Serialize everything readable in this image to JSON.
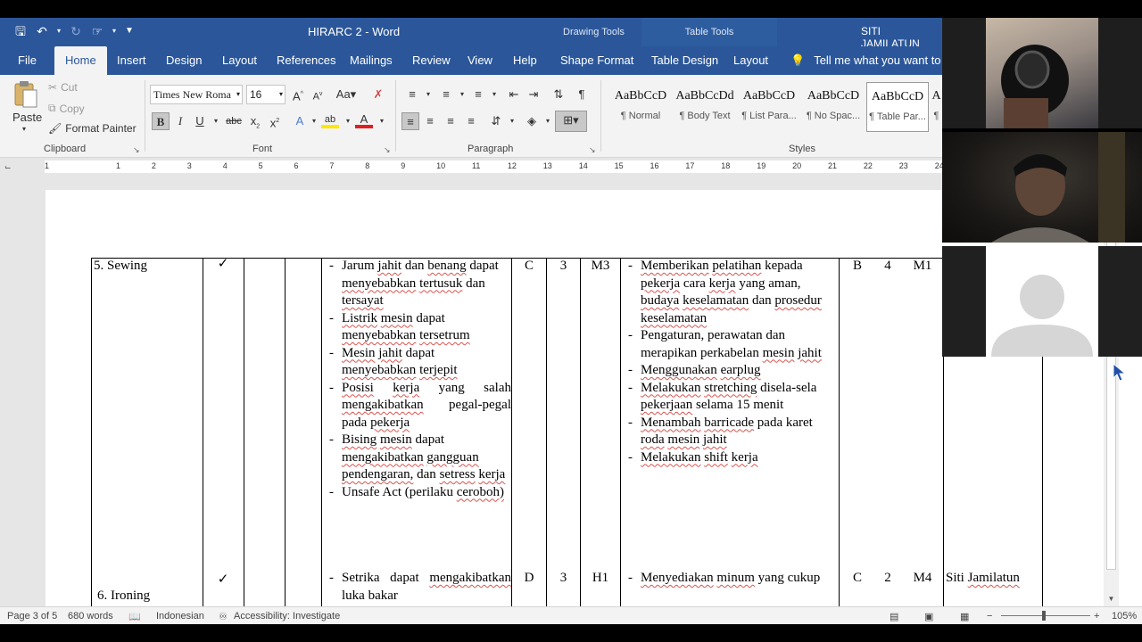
{
  "window": {
    "title": "HIRARC 2  -  Word",
    "user": "SITI JAMILATUN",
    "context_headers": [
      "Drawing Tools",
      "Table Tools"
    ]
  },
  "tabs": [
    "File",
    "Home",
    "Insert",
    "Design",
    "Layout",
    "References",
    "Mailings",
    "Review",
    "View",
    "Help",
    "Shape Format",
    "Table Design",
    "Layout"
  ],
  "active_tab": "Home",
  "tell_me": "Tell me what you want to d",
  "clipboard": {
    "paste": "Paste",
    "cut": "Cut",
    "copy": "Copy",
    "format_painter": "Format Painter",
    "label": "Clipboard"
  },
  "font": {
    "family": "Times New Roma",
    "size": "16",
    "label": "Font"
  },
  "paragraph": {
    "label": "Paragraph"
  },
  "styles": {
    "label": "Styles",
    "items": [
      {
        "sample": "AaBbCcD",
        "name": "¶ Normal"
      },
      {
        "sample": "AaBbCcDd",
        "name": "¶ Body Text"
      },
      {
        "sample": "AaBbCcD",
        "name": "¶ List Para..."
      },
      {
        "sample": "AaBbCcD",
        "name": "¶ No Spac..."
      },
      {
        "sample": "AaBbCcD",
        "name": "¶ Table Par..."
      },
      {
        "sample": "A",
        "name": "¶"
      }
    ]
  },
  "ruler": {
    "numbers": [
      "1",
      "1",
      "2",
      "3",
      "4",
      "5",
      "6",
      "7",
      "8",
      "9",
      "10",
      "11",
      "12",
      "13",
      "14",
      "15",
      "16",
      "17",
      "18",
      "19",
      "20",
      "21",
      "22",
      "23",
      "24"
    ]
  },
  "document": {
    "rows": [
      {
        "activity": "5.  Sewing",
        "check": "✓",
        "hazards": [
          "Jarum jahit dan benang dapat menyebabkan tertusuk dan tersayat",
          "Listrik mesin dapat menyebabkan tersetrum",
          "Mesin jahit dapat menyebabkan terjepit",
          "Posisi kerja yang salah mengakibatkan pegal-pegal pada pekerja",
          "Bising mesin dapat mengakibatkan gangguan pendengaran, dan setress kerja",
          "Unsafe Act (perilaku ceroboh)"
        ],
        "likelihood": "C",
        "severity": "3",
        "risk": "M3",
        "controls": [
          "Memberikan pelatihan kepada pekerja cara kerja yang aman, budaya keselamatan dan prosedur keselamatan",
          "Pengaturan, perawatan dan merapikan perkabelan mesin jahit",
          "Menggunakan earplug",
          "Melakukan stretching disela-sela pekerjaan selama 15 menit",
          "Menambah barricade pada karet roda mesin jahit",
          "Melakukan shift kerja"
        ],
        "likelihood2": "B",
        "severity2": "4",
        "risk2": "M1",
        "pic": ""
      },
      {
        "activity": "6. Ironing",
        "check": "✓",
        "hazards": [
          "Setrika dapat mengakibatkan luka bakar"
        ],
        "likelihood": "D",
        "severity": "3",
        "risk": "H1",
        "controls": [
          "Menyediakan minum yang cukup"
        ],
        "likelihood2": "C",
        "severity2": "2",
        "risk2": "M4",
        "pic": "Siti Jamilatun"
      }
    ]
  },
  "status": {
    "page": "Page 3 of 5",
    "words": "680 words",
    "language": "Indonesian",
    "accessibility": "Accessibility: Investigate",
    "zoom": "105%"
  }
}
